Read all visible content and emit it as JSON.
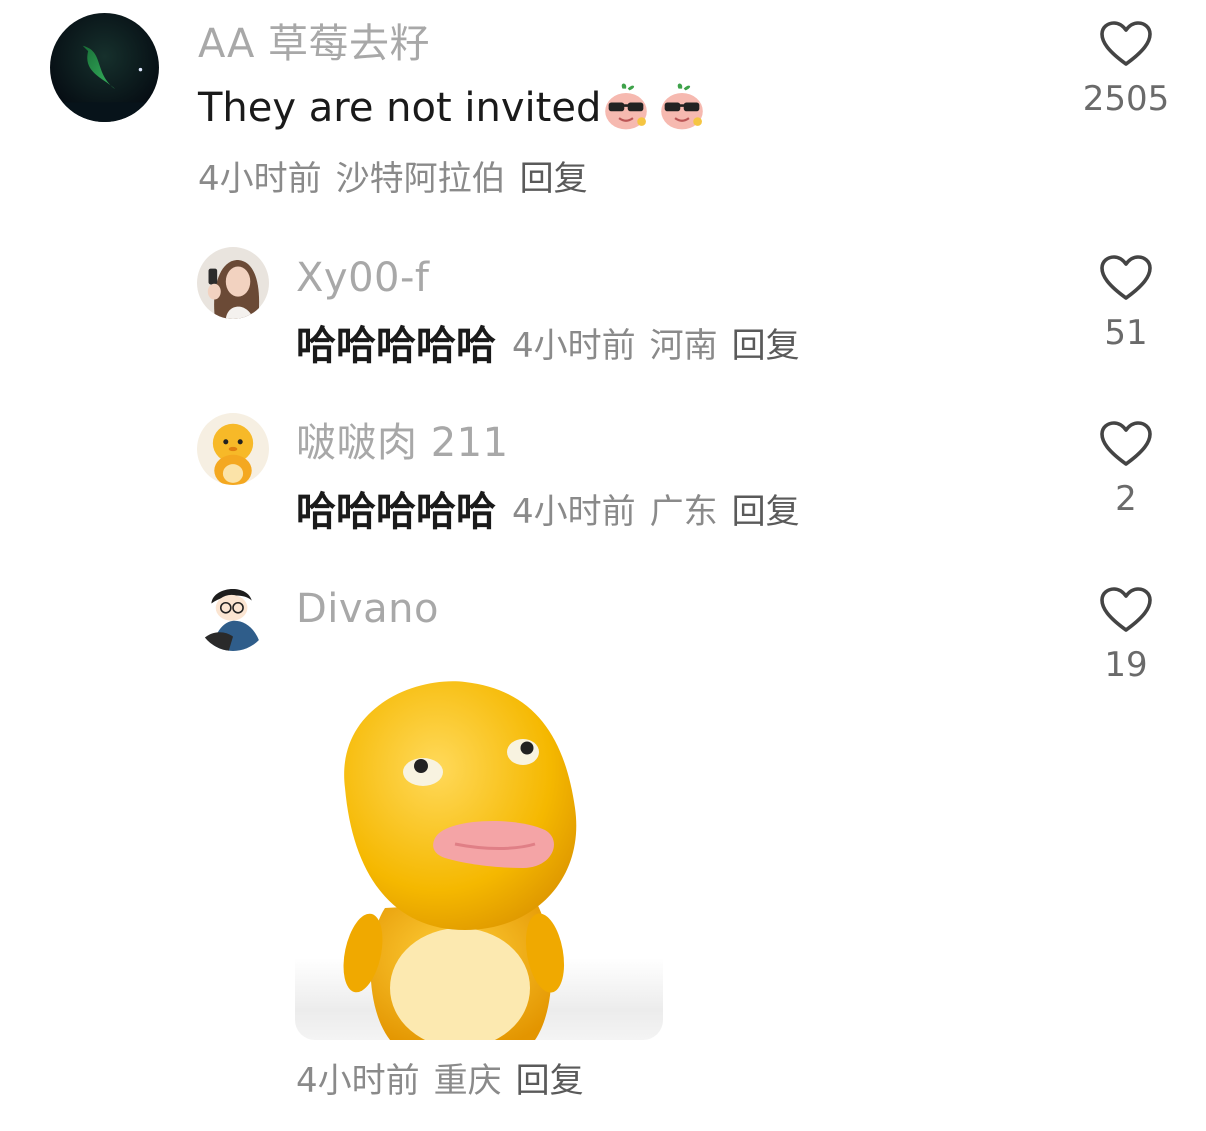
{
  "comments": [
    {
      "username": "AA 草莓去籽",
      "text": "They are not invited",
      "emojis": [
        "sunglasses-sticker",
        "sunglasses-sticker"
      ],
      "time": "4小时前",
      "location": "沙特阿拉伯",
      "reply": "回复",
      "likes": "2505",
      "avatar": "aurora-avatar"
    },
    {
      "username": "Xy00-f",
      "text": "哈哈哈哈哈",
      "time": "4小时前",
      "location": "河南",
      "reply": "回复",
      "likes": "51",
      "avatar": "girl-portrait-avatar"
    },
    {
      "username": "啵啵肉 211",
      "text": "哈哈哈哈哈",
      "time": "4小时前",
      "location": "广东",
      "reply": "回复",
      "likes": "2",
      "avatar": "yellow-duck-avatar"
    },
    {
      "username": "Divano",
      "sticker": "yellow-duck-tongue-sticker",
      "time": "4小时前",
      "location": "重庆",
      "reply": "回复",
      "likes": "19",
      "avatar": "cartoon-boy-avatar"
    }
  ],
  "colors": {
    "username": "#a8a8a8",
    "text": "#1a1a1a",
    "meta": "#8a8a8a",
    "heart_stroke": "#444444",
    "sticker_yellow": "#f5b800"
  }
}
